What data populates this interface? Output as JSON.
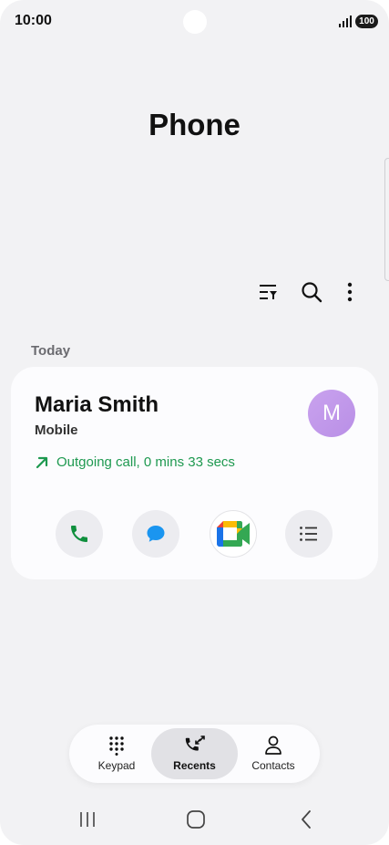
{
  "status_bar": {
    "time": "10:00",
    "battery": "100",
    "signal_icon": "signal-bars-icon"
  },
  "page": {
    "title": "Phone"
  },
  "toolbar": {
    "icons": [
      "filter-icon",
      "search-icon",
      "more-vert-icon"
    ]
  },
  "recents": {
    "section_header": "Today",
    "entry": {
      "name": "Maria Smith",
      "type": "Mobile",
      "avatar_initial": "M",
      "call_detail": "Outgoing call, 0 mins 33 secs",
      "call_direction_icon": "outgoing-arrow-icon"
    },
    "actions": [
      "phone-icon",
      "message-icon",
      "google-meet-icon",
      "details-list-icon"
    ]
  },
  "bottom_nav": {
    "items": [
      {
        "label": "Keypad",
        "icon": "keypad-icon",
        "active": false
      },
      {
        "label": "Recents",
        "icon": "recents-call-icon",
        "active": true
      },
      {
        "label": "Contacts",
        "icon": "person-icon",
        "active": false
      }
    ]
  },
  "system_nav": {
    "icons": [
      "recent-apps-icon",
      "home-icon",
      "back-icon"
    ]
  },
  "colors": {
    "accent_green": "#1e9950",
    "call_green": "#0f8f3d",
    "message_blue": "#1a95f0",
    "avatar_purple": "#c39be9",
    "background": "#f2f2f4"
  }
}
